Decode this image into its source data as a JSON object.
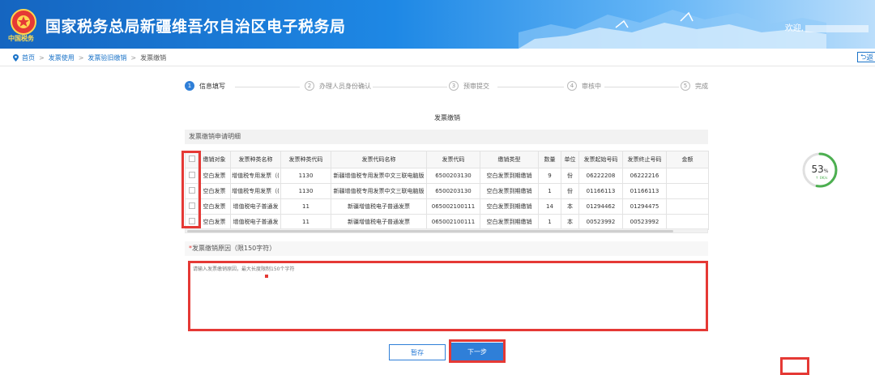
{
  "header": {
    "title": "国家税务总局新疆维吾尔自治区电子税务局",
    "brand_sub": "中国税务",
    "welcome": "欢迎,"
  },
  "breadcrumb": {
    "items": [
      "首页",
      "发票使用",
      "发票验旧缴销",
      "发票缴销"
    ],
    "back_label": "返"
  },
  "steps": [
    {
      "num": "1",
      "label": "信息填写",
      "active": true
    },
    {
      "num": "2",
      "label": "办理人员身份确认",
      "active": false
    },
    {
      "num": "3",
      "label": "预审提交",
      "active": false
    },
    {
      "num": "4",
      "label": "审核中",
      "active": false
    },
    {
      "num": "5",
      "label": "完成",
      "active": false
    }
  ],
  "form_title": "发票缴销",
  "detail_section": {
    "title": "发票缴销申请明细",
    "columns": [
      "",
      "缴销对象",
      "发票种类名称",
      "发票种类代码",
      "发票代码名称",
      "发票代码",
      "缴销类型",
      "数量",
      "单位",
      "发票起始号码",
      "发票终止号码",
      "金额"
    ],
    "rows": [
      [
        "空白发票",
        "增值税专用发票（(",
        "1130",
        "新疆增值税专用发票中文三联电脑版",
        "6500203130",
        "空白发票到期缴销",
        "9",
        "份",
        "06222208",
        "06222216",
        ""
      ],
      [
        "空白发票",
        "增值税专用发票（(",
        "1130",
        "新疆增值税专用发票中文三联电脑版",
        "6500203130",
        "空白发票到期缴销",
        "1",
        "份",
        "01166113",
        "01166113",
        ""
      ],
      [
        "空白发票",
        "增值税电子普通发",
        "11",
        "新疆增值税电子普通发票",
        "065002100111",
        "空白发票到期缴销",
        "14",
        "本",
        "01294462",
        "01294475",
        ""
      ],
      [
        "空白发票",
        "增值税电子普通发",
        "11",
        "新疆增值税电子普通发票",
        "065002100111",
        "空白发票到期缴销",
        "1",
        "本",
        "00523992",
        "00523992",
        ""
      ]
    ]
  },
  "reason_section": {
    "required_mark": "*",
    "title": "发票缴销原因（限150字符）",
    "placeholder": "请输入发票缴销原因，最大长度限制150个字符",
    "value": ""
  },
  "buttons": {
    "save": "暂存",
    "next": "下一步"
  },
  "gauge": {
    "percent": 53,
    "percent_sign": "%",
    "speed": "0K/s",
    "color": "#4caf50"
  },
  "colors": {
    "primary": "#2f7fd8",
    "highlight": "#e53935"
  }
}
